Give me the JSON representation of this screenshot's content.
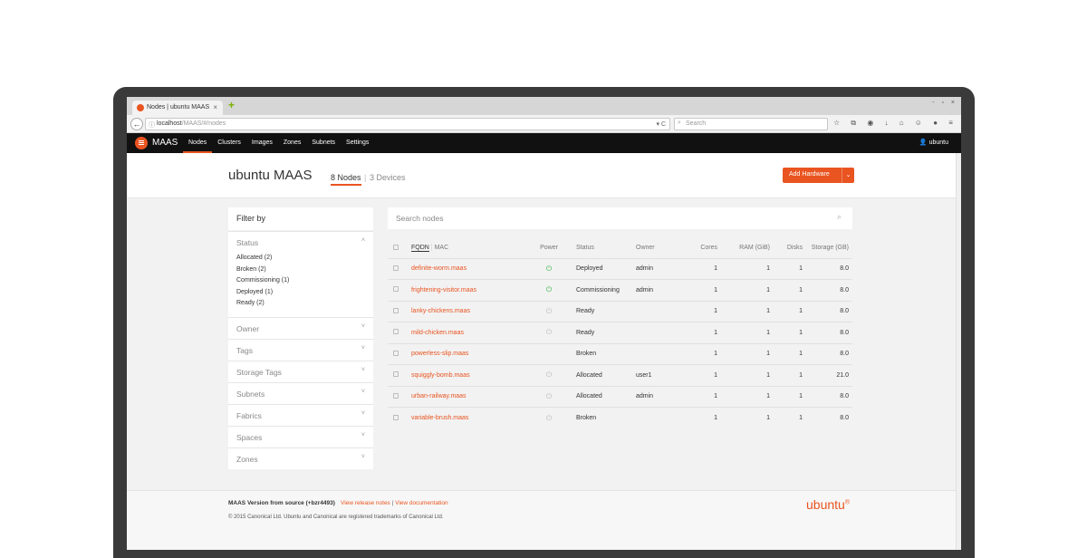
{
  "browser": {
    "tab_title": "Nodes | ubuntu MAAS",
    "tab_close": "×",
    "new_tab": "+",
    "window_controls": "- ▫ ×",
    "back": "←",
    "url_host": "localhost",
    "url_path": "/MAAS/#/nodes",
    "url_right": "▾ C",
    "search_placeholder": "Search",
    "toolbar_icons": "☆ ⧉ ◉ ↓ ⌂ ☺ ● ≡"
  },
  "header": {
    "logo": "MAAS",
    "nav": [
      {
        "label": "Nodes",
        "active": true
      },
      {
        "label": "Clusters"
      },
      {
        "label": "Images"
      },
      {
        "label": "Zones"
      },
      {
        "label": "Subnets"
      },
      {
        "label": "Settings"
      }
    ],
    "user": "ubuntu"
  },
  "page": {
    "title": "ubuntu MAAS",
    "tab_nodes": "8 Nodes",
    "tab_sep": "|",
    "tab_devices": "3 Devices",
    "add_hardware": "Add Hardware",
    "add_caret": "⌄"
  },
  "filter": {
    "heading": "Filter by",
    "status_title": "Status",
    "status_items": [
      "Allocated (2)",
      "Broken (2)",
      "Commissioning (1)",
      "Deployed (1)",
      "Ready (2)"
    ],
    "sections": [
      "Owner",
      "Tags",
      "Storage Tags",
      "Subnets",
      "Fabrics",
      "Spaces",
      "Zones"
    ],
    "chev_up": "˄",
    "chev_down": "˅"
  },
  "search": {
    "placeholder": "Search nodes"
  },
  "table": {
    "headers": {
      "fqdn": "FQDN",
      "sep": "|",
      "mac": "MAC",
      "power": "Power",
      "status": "Status",
      "owner": "Owner",
      "cores": "Cores",
      "ram": "RAM (GiB)",
      "disks": "Disks",
      "storage": "Storage (GB)"
    },
    "rows": [
      {
        "fqdn": "definite-worm.maas",
        "power": "on",
        "status": "Deployed",
        "owner": "admin",
        "cores": "1",
        "ram": "1",
        "disks": "1",
        "storage": "8.0"
      },
      {
        "fqdn": "frightening-visitor.maas",
        "power": "on",
        "status": "Commissioning",
        "owner": "admin",
        "cores": "1",
        "ram": "1",
        "disks": "1",
        "storage": "8.0"
      },
      {
        "fqdn": "lanky-chickens.maas",
        "power": "off",
        "status": "Ready",
        "owner": "",
        "cores": "1",
        "ram": "1",
        "disks": "1",
        "storage": "8.0"
      },
      {
        "fqdn": "mild-chicken.maas",
        "power": "off",
        "status": "Ready",
        "owner": "",
        "cores": "1",
        "ram": "1",
        "disks": "1",
        "storage": "8.0"
      },
      {
        "fqdn": "powerless-slip.maas",
        "power": "none",
        "status": "Broken",
        "owner": "",
        "cores": "1",
        "ram": "1",
        "disks": "1",
        "storage": "8.0"
      },
      {
        "fqdn": "squiggly-bomb.maas",
        "power": "off",
        "status": "Allocated",
        "owner": "user1",
        "cores": "1",
        "ram": "1",
        "disks": "1",
        "storage": "21.0"
      },
      {
        "fqdn": "urban-railway.maas",
        "power": "off",
        "status": "Allocated",
        "owner": "admin",
        "cores": "1",
        "ram": "1",
        "disks": "1",
        "storage": "8.0"
      },
      {
        "fqdn": "variable-brush.maas",
        "power": "off",
        "status": "Broken",
        "owner": "",
        "cores": "1",
        "ram": "1",
        "disks": "1",
        "storage": "8.0"
      }
    ]
  },
  "footer": {
    "version": "MAAS Version from source (+bzr4493)",
    "release_notes": "View release notes",
    "link_sep": "|",
    "documentation": "View documentation",
    "copyright": "© 2015 Canonical Ltd. Ubuntu and Canonical are registered trademarks of Canonical Ltd.",
    "brand": "ubuntu",
    "brand_mark": "®"
  },
  "colors": {
    "accent": "#e95420",
    "power_on": "#38b44a",
    "header_bg": "#111111"
  }
}
